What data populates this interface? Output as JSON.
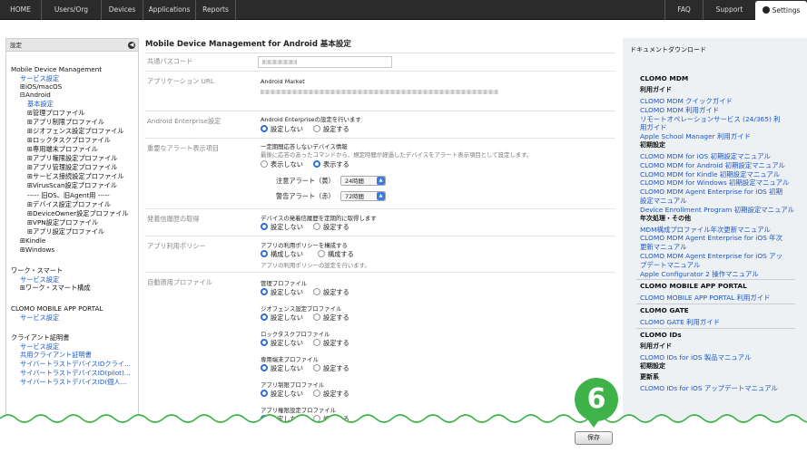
{
  "nav": {
    "home": "HOME",
    "users": "Users/Org",
    "devices": "Devices",
    "applications": "Applications",
    "reports": "Reports",
    "faq": "FAQ",
    "support": "Support",
    "settings": "Settings"
  },
  "sidebar": {
    "title": "設定",
    "items": [
      "Mobile Device Management",
      "サービス設定",
      "⊞iOS/macOS",
      "⊟Android",
      "基本設定",
      "⊞管理プロファイル",
      "⊞アプリ制限プロファイル",
      "⊞ジオフェンス設定プロファイル",
      "⊞ロックタスクプロファイル",
      "⊞専用端末プロファイル",
      "⊞アプリ権限設定プロファイル",
      "⊞アプリ管理設定プロファイル",
      "⊞サービス接続設定プロファイル",
      "⊞VirusScan設定プロファイル",
      "----- 旧OS、旧Agent用 -----",
      "⊞デバイス設定プロファイル",
      "⊞DeviceOwner設定プロファイル",
      "⊞VPN設定プロファイル",
      "⊞アプリ設定プロファイル",
      "⊞Kindle",
      "⊞Windows",
      "ワーク・スマート",
      "サービス設定",
      "⊞ワーク・スマート構成",
      "CLOMO MOBILE APP PORTAL",
      "サービス設定",
      "クライアント証明書",
      "サービス設定",
      "共用クライアント証明書",
      "サイバートラストデバイスIDクライ...",
      "サイバートラストデバイスID(pilot)...",
      "サイバートラストデバイスID(個人..."
    ]
  },
  "main": {
    "title": "Mobile Device Management for Android 基本設定",
    "rows": {
      "passcode": "共通パスコード",
      "app_url": "アプリケーション URL",
      "app_url_market": "Android Market",
      "enterprise": "Android Enterprise設定",
      "enterprise_desc": "Android Enterpriseの設定を行います",
      "alert": "重要なアラート表示項目",
      "alert_desc1": "一定期間応答しないデバイス情報",
      "alert_desc2": "最後に応答のあったコマンドから、規定時間が経過したデバイスをアラート表示項目として設定します。",
      "caution_label": "注意アラート（黄）",
      "caution_value": "24時間",
      "warning_label": "警告アラート（赤）",
      "warning_value": "72時間",
      "location": "発着信履歴の取得",
      "location_desc": "デバイスの発着信履歴を定期的に取得します",
      "policy": "アプリ利用ポリシー",
      "policy_desc": "アプリの利用ポリシーを構成する",
      "policy_note": "アプリの利用ポリシーの設定を行います。",
      "auto_profile": "自動適用プロファイル",
      "prof_manage": "管理プロファイル",
      "prof_geofence": "ジオフェンス設定プロファイル",
      "prof_locktask": "ロックタスクプロファイル",
      "prof_dedicated": "専用端末プロファイル",
      "prof_restrict": "アプリ制限プロファイル",
      "prof_permission": "アプリ権限設定プロファイル"
    },
    "opt_off": "設定しない",
    "opt_on": "設定する",
    "opt_hide": "表示しない",
    "opt_show": "表示する",
    "opt_noconf": "構成しない",
    "opt_conf": "構成する",
    "save": "保存",
    "step": "6"
  },
  "right": {
    "heading": "ドキュメントダウンロード",
    "entries": [
      {
        "k": "s",
        "t": "CLOMO MDM"
      },
      {
        "k": "s2",
        "t": "利用ガイド"
      },
      {
        "k": "l",
        "t": "CLOMO MDM クイックガイド"
      },
      {
        "k": "l",
        "t": "CLOMO MDM 利用ガイド"
      },
      {
        "k": "l",
        "t": "リモートオペレーションサービス (24/365) 利"
      },
      {
        "k": "l",
        "t": "用ガイド"
      },
      {
        "k": "l",
        "t": "Apple School Manager 利用ガイド"
      },
      {
        "k": "s2",
        "t": "初期設定"
      },
      {
        "k": "l",
        "t": "CLOMO MDM for iOS 初期設定マニュアル"
      },
      {
        "k": "l",
        "t": "CLOMO MDM for Android 初期設定マニュアル"
      },
      {
        "k": "l",
        "t": "CLOMO MDM for Kindle 初期設定マニュアル"
      },
      {
        "k": "l",
        "t": "CLOMO MDM for Windows 初期設定マニュアル"
      },
      {
        "k": "l",
        "t": "CLOMO MDM Agent Enterprise for iOS 初期"
      },
      {
        "k": "l",
        "t": "設定マニュアル"
      },
      {
        "k": "l",
        "t": "Device Enrollment Program 初期設定マニュアル"
      },
      {
        "k": "s2",
        "t": "年次処理・その他"
      },
      {
        "k": "l",
        "t": "MDM構成プロファイル年次更新マニュアル"
      },
      {
        "k": "l",
        "t": "CLOMO MDM Agent Enterprise for iOS 年次"
      },
      {
        "k": "l",
        "t": "更新マニュアル"
      },
      {
        "k": "l",
        "t": "CLOMO MDM Agent Enterprise for iOS アッ"
      },
      {
        "k": "l",
        "t": "プデートマニュアル"
      },
      {
        "k": "l",
        "t": "Apple Configurator 2 操作マニュアル"
      },
      {
        "k": "s",
        "t": "CLOMO MOBILE APP PORTAL"
      },
      {
        "k": "l",
        "t": "CLOMO MOBILE APP PORTAL 利用ガイド"
      },
      {
        "k": "s",
        "t": "CLOMO GATE"
      },
      {
        "k": "l",
        "t": "CLOMO GATE 利用ガイド"
      },
      {
        "k": "s",
        "t": "CLOMO IDs"
      },
      {
        "k": "s2",
        "t": "利用ガイド"
      },
      {
        "k": "l",
        "t": "CLOMO IDs for iOS 製品マニュアル"
      },
      {
        "k": "s2",
        "t": "初期設定"
      },
      {
        "k": "s2",
        "t": "更新系"
      },
      {
        "k": "l",
        "t": "CLOMO IDs for iOS アップデートマニュアル"
      }
    ]
  }
}
